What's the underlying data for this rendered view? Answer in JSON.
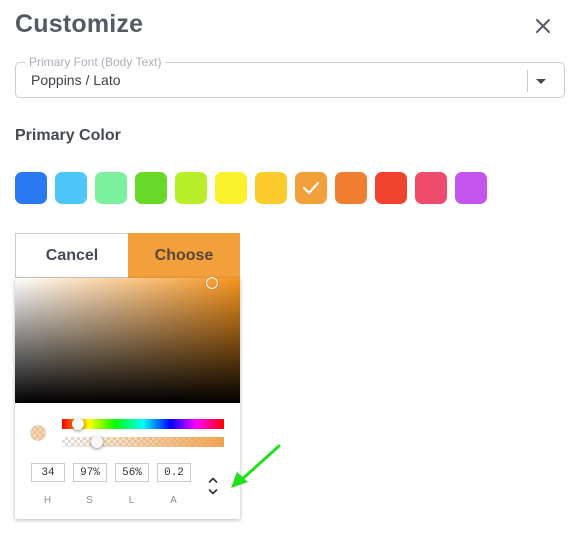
{
  "dialog": {
    "title": "Customize",
    "close_icon": "close-icon"
  },
  "font_select": {
    "label": "Primary Font (Body Text)",
    "value": "Poppins / Lato",
    "caret_icon": "caret-down-icon"
  },
  "primary_color": {
    "label": "Primary Color",
    "selected_index": 7,
    "swatches": [
      {
        "color": "#2b78f3"
      },
      {
        "color": "#4fc6f8"
      },
      {
        "color": "#7df0a0"
      },
      {
        "color": "#68d92a"
      },
      {
        "color": "#b8ee2a"
      },
      {
        "color": "#f8f12c"
      },
      {
        "color": "#fccc2f"
      },
      {
        "color": "#f2a03c"
      },
      {
        "color": "#f07e30"
      },
      {
        "color": "#ef4330"
      },
      {
        "color": "#ef4b6d"
      },
      {
        "color": "#c454ec"
      }
    ]
  },
  "actions": {
    "cancel_label": "Cancel",
    "choose_label": "Choose"
  },
  "color_picker": {
    "h": "34",
    "s": "97%",
    "l": "56%",
    "a": "0.2",
    "labels": {
      "h": "H",
      "s": "S",
      "l": "L",
      "a": "A"
    },
    "toggle_icon": "chevron-up-down-icon"
  },
  "annotation": {
    "arrow_icon": "green-arrow-icon",
    "arrow_color": "#22e01c"
  }
}
